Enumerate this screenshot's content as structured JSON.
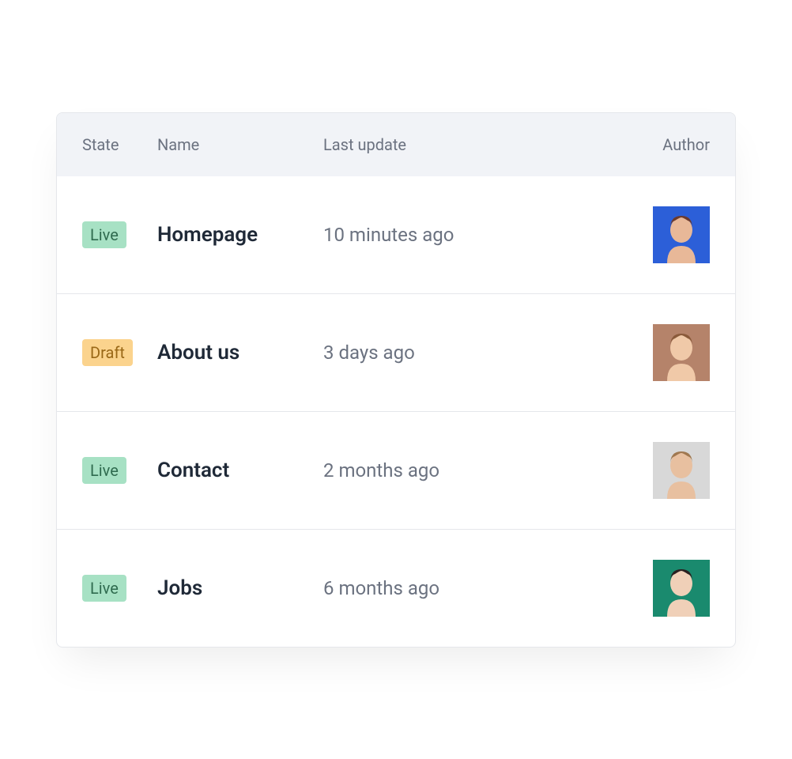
{
  "table": {
    "headers": {
      "state": "State",
      "name": "Name",
      "last_update": "Last update",
      "author": "Author"
    },
    "rows": [
      {
        "state": "Live",
        "state_type": "live",
        "name": "Homepage",
        "last_update": "10 minutes ago",
        "avatar": {
          "bg": "#2c5fd8",
          "skin": "#e8b898",
          "hair": "#6b3a2e"
        }
      },
      {
        "state": "Draft",
        "state_type": "draft",
        "name": "About us",
        "last_update": "3 days ago",
        "avatar": {
          "bg": "#b5836a",
          "skin": "#f0c9a8",
          "hair": "#8a5a3a"
        }
      },
      {
        "state": "Live",
        "state_type": "live",
        "name": "Contact",
        "last_update": "2 months ago",
        "avatar": {
          "bg": "#d8d8d8",
          "skin": "#e8c0a0",
          "hair": "#a07850"
        }
      },
      {
        "state": "Live",
        "state_type": "live",
        "name": "Jobs",
        "last_update": "6 months ago",
        "avatar": {
          "bg": "#1a8a6e",
          "skin": "#f0d0b8",
          "hair": "#2a2020"
        }
      }
    ]
  }
}
